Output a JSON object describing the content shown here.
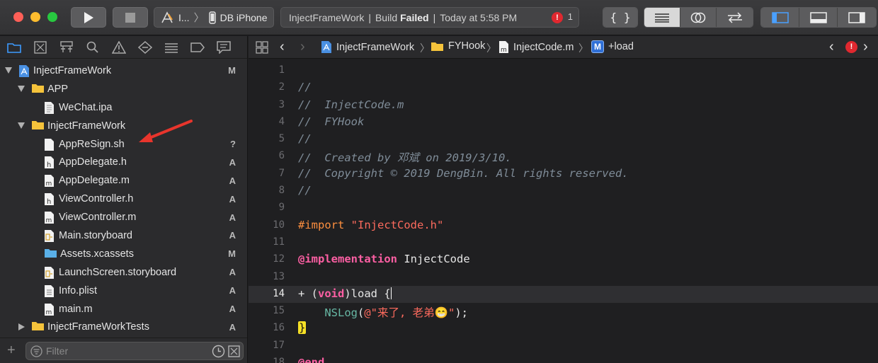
{
  "toolbar": {
    "scheme_label": "I...",
    "device_label": "DB iPhone",
    "status": {
      "project": "InjectFrameWork",
      "separator": "|",
      "build_label": "Build",
      "build_result": "Failed",
      "time": "Today at 5:58 PM",
      "error_count": "1",
      "error_glyph": "!"
    },
    "braces_label": "{ }"
  },
  "navigator": {
    "items": [
      {
        "label": "InjectFrameWork",
        "badge": "M",
        "icon": "project-icon",
        "disclosure": "open"
      },
      {
        "label": "APP",
        "badge": "",
        "icon": "folder-icon",
        "disclosure": "open"
      },
      {
        "label": "WeChat.ipa",
        "badge": "",
        "icon": "ipa-file-icon",
        "disclosure": ""
      },
      {
        "label": "InjectFrameWork",
        "badge": "",
        "icon": "folder-icon",
        "disclosure": "open"
      },
      {
        "label": "AppReSign.sh",
        "badge": "?",
        "icon": "file-icon",
        "disclosure": ""
      },
      {
        "label": "AppDelegate.h",
        "badge": "A",
        "icon": "header-file-icon",
        "disclosure": ""
      },
      {
        "label": "AppDelegate.m",
        "badge": "A",
        "icon": "m-file-icon",
        "disclosure": ""
      },
      {
        "label": "ViewController.h",
        "badge": "A",
        "icon": "header-file-icon",
        "disclosure": ""
      },
      {
        "label": "ViewController.m",
        "badge": "A",
        "icon": "m-file-icon",
        "disclosure": ""
      },
      {
        "label": "Main.storyboard",
        "badge": "A",
        "icon": "storyboard-icon",
        "disclosure": ""
      },
      {
        "label": "Assets.xcassets",
        "badge": "M",
        "icon": "assets-icon",
        "disclosure": ""
      },
      {
        "label": "LaunchScreen.storyboard",
        "badge": "A",
        "icon": "storyboard-icon",
        "disclosure": ""
      },
      {
        "label": "Info.plist",
        "badge": "A",
        "icon": "plist-icon",
        "disclosure": ""
      },
      {
        "label": "main.m",
        "badge": "A",
        "icon": "m-file-icon",
        "disclosure": ""
      },
      {
        "label": "InjectFrameWorkTests",
        "badge": "A",
        "icon": "folder-icon",
        "disclosure": "closed"
      }
    ],
    "filter_placeholder": "Filter"
  },
  "editor": {
    "jumpbar": {
      "project": "InjectFrameWork",
      "group": "FYHook",
      "file": "InjectCode.m",
      "method_badge": "M",
      "method": "+load"
    },
    "lines": {
      "n1": "1",
      "n2": "2",
      "n3": "3",
      "n4": "4",
      "n5": "5",
      "n6": "6",
      "n7": "7",
      "n8": "8",
      "n9": "9",
      "n10": "10",
      "n11": "11",
      "n12": "12",
      "n13": "13",
      "n14": "14",
      "n15": "15",
      "n16": "16",
      "n17": "17",
      "n18": "18",
      "l2": "//",
      "l3": "//  InjectCode.m",
      "l4": "//  FYHook",
      "l5": "//",
      "l6": "//  Created by 邓斌 on 2019/3/10.",
      "l7": "//  Copyright © 2019 DengBin. All rights reserved.",
      "l8": "//",
      "l10_directive": "#import",
      "l10_string": "\"InjectCode.h\"",
      "l12_keyword": "@implementation",
      "l12_name": "InjectCode",
      "l14_plus": "+ (",
      "l14_void": "void",
      "l14_rest": ")load {",
      "l15_fn": "NSLog",
      "l15_open": "(",
      "l15_string": "@\"来了, 老弟😁\"",
      "l15_close": ");",
      "l16_brace": "}",
      "l18_end": "@end"
    }
  }
}
